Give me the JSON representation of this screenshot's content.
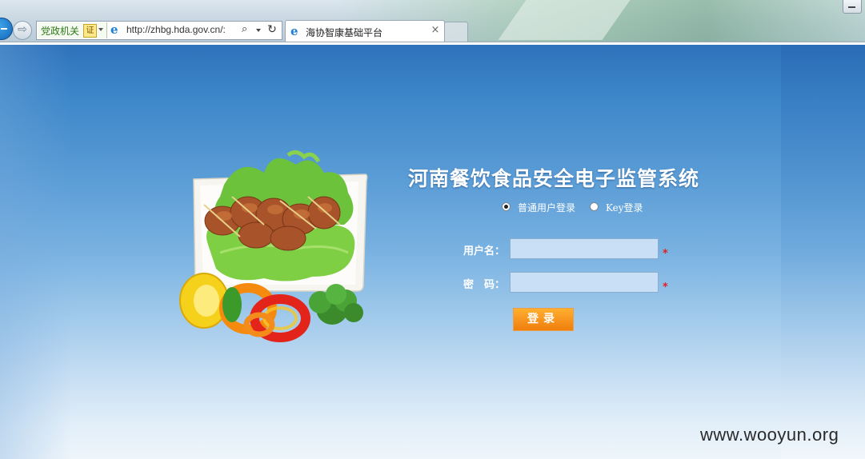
{
  "browser": {
    "forward_glyph": "⇨",
    "security_badge": "党政机关",
    "security_cert_glyph": "证",
    "ie_glyph": "e",
    "url": "http://zhbg.hda.gov.cn/:",
    "search_glyph": "⌕",
    "refresh_glyph": "↻",
    "tab": {
      "title": "海协智康基础平台",
      "close_glyph": "×"
    }
  },
  "login": {
    "system_title": "河南餐饮食品安全电子监管系统",
    "login_modes": [
      {
        "label": "普通用户登录",
        "checked": true
      },
      {
        "label": "Key登录",
        "checked": false
      }
    ],
    "username_label": "用户名：",
    "username_value": "",
    "password_label": "密　码：",
    "password_value": "",
    "required_mark": "*",
    "submit_label": "登录"
  },
  "watermark": "www.wooyun.org"
}
